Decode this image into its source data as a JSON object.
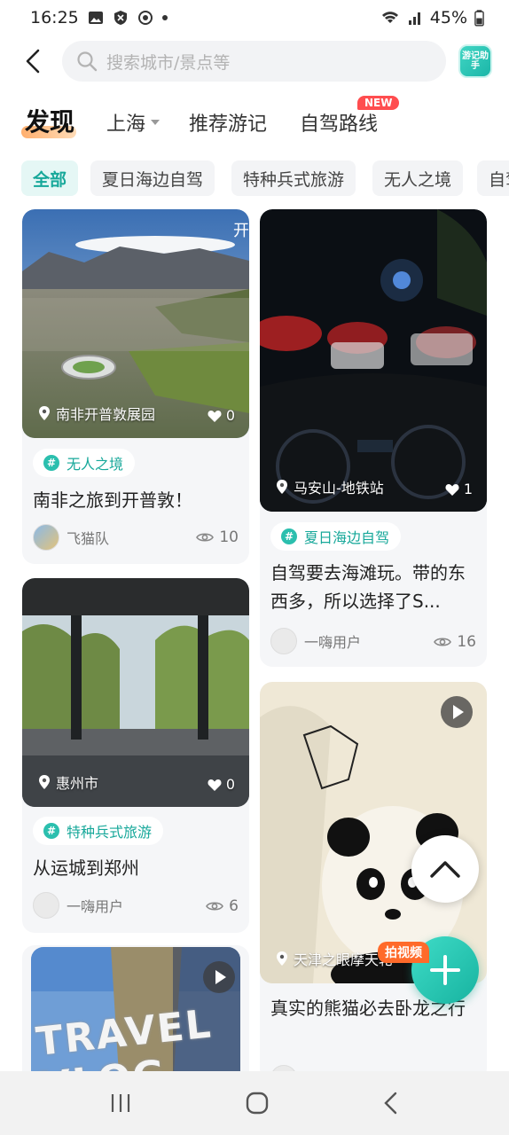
{
  "status_bar": {
    "time": "16:25",
    "battery": "45%"
  },
  "header": {
    "search_placeholder": "搜索城市/景点等",
    "assistant_label": "游记助手"
  },
  "tabs": {
    "discover": "发现",
    "city": "上海",
    "recommended": "推荐游记",
    "routes": "自驾路线",
    "new_badge": "NEW"
  },
  "chips": [
    "全部",
    "夏日海边自驾",
    "特种兵式旅游",
    "无人之境",
    "自驾"
  ],
  "feed": {
    "left": [
      {
        "image_overlay_text": "开",
        "location": "南非开普敦展园",
        "likes": "0",
        "tag": "无人之境",
        "title": "南非之旅到开普敦！",
        "author": "飞猫队",
        "views": "10"
      },
      {
        "location": "惠州市",
        "likes": "0",
        "tag": "特种兵式旅游",
        "title": "从运城到郑州",
        "author": "一嗨用户",
        "views": "6"
      },
      {
        "image_text": "TRAVEL VLOG"
      }
    ],
    "right": [
      {
        "location": "马安山-地铁站",
        "likes": "1",
        "tag": "夏日海边自驾",
        "title": "自驾要去海滩玩。带的东西多，所以选择了S...",
        "author": "一嗨用户",
        "views": "16"
      },
      {
        "location": "天津之眼摩天轮",
        "video_badge": "拍视频",
        "title": "真实的熊猫必去卧龙之行"
      }
    ]
  },
  "colors": {
    "accent": "#17a89a",
    "new_badge": "#ff4d4f",
    "video_badge": "#ff6a2a"
  }
}
